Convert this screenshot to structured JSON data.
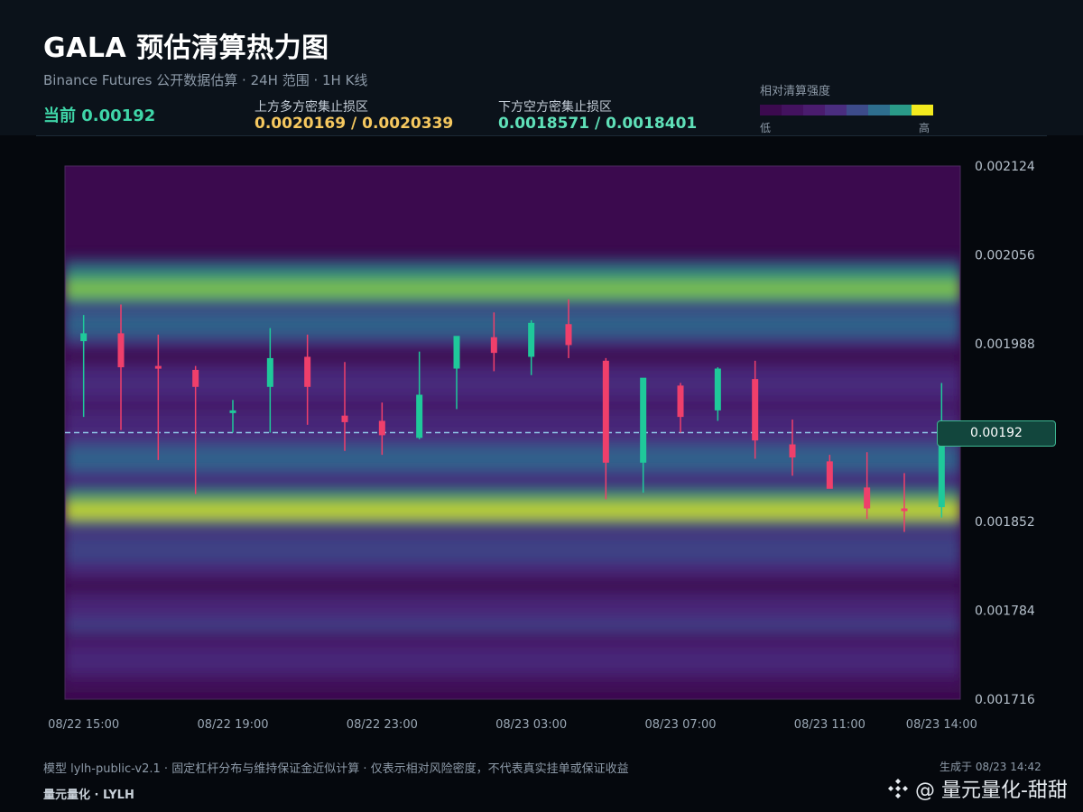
{
  "header": {
    "title": "GALA 预估清算热力图",
    "subtitle": "Binance Futures 公开数据估算 · 24H 范围 · 1H K线",
    "current": "当前 0.00192",
    "upper_zone_label": "上方多方密集止损区",
    "upper_zone_value": "0.0020169 / 0.0020339",
    "lower_zone_label": "下方空方密集止损区",
    "lower_zone_value": "0.0018571 / 0.0018401",
    "legend_title": "相对清算强度",
    "legend_low": "低",
    "legend_high": "高",
    "legend_colors": [
      "#3b0a4e",
      "#43125f",
      "#4a1c6e",
      "#4a2d7f",
      "#3d4b8a",
      "#2e6e8e",
      "#2a9a88",
      "#f3ea1e"
    ]
  },
  "colors": {
    "up": "#1fc99a",
    "down": "#ef3f6b",
    "current_line": "#8fc8e8",
    "upper_value": "#f6c85f",
    "lower_value": "#5fe0b8"
  },
  "chart_data": {
    "type": "heatmap",
    "overlay": "candlestick",
    "x_labels": [
      "08/22 15:00",
      "08/22 19:00",
      "08/22 23:00",
      "08/23 03:00",
      "08/23 07:00",
      "08/23 11:00",
      "08/23 14:00"
    ],
    "y_ticks": [
      "0.002124",
      "0.002056",
      "0.001988",
      "0.001920",
      "0.001852",
      "0.001784",
      "0.001716"
    ],
    "ylim": [
      0.001716,
      0.002124
    ],
    "current_price": 0.00192,
    "current_price_label": "0.00192",
    "candles": [
      {
        "o": 0.00199,
        "h": 0.00201,
        "l": 0.001932,
        "c": 0.001996
      },
      {
        "o": 0.001996,
        "h": 0.002018,
        "l": 0.001922,
        "c": 0.00197
      },
      {
        "o": 0.001971,
        "h": 0.001995,
        "l": 0.001899,
        "c": 0.001969
      },
      {
        "o": 0.001968,
        "h": 0.001971,
        "l": 0.001873,
        "c": 0.001955
      },
      {
        "o": 0.001935,
        "h": 0.001945,
        "l": 0.00192,
        "c": 0.001937
      },
      {
        "o": 0.001955,
        "h": 0.002,
        "l": 0.00192,
        "c": 0.001977
      },
      {
        "o": 0.001978,
        "h": 0.001995,
        "l": 0.001926,
        "c": 0.001955
      },
      {
        "o": 0.001933,
        "h": 0.001974,
        "l": 0.001906,
        "c": 0.001928
      },
      {
        "o": 0.001929,
        "h": 0.001943,
        "l": 0.001903,
        "c": 0.001918
      },
      {
        "o": 0.001916,
        "h": 0.001982,
        "l": 0.001915,
        "c": 0.001949
      },
      {
        "o": 0.001969,
        "h": 0.001991,
        "l": 0.001938,
        "c": 0.001994
      },
      {
        "o": 0.001993,
        "h": 0.002012,
        "l": 0.001967,
        "c": 0.001981
      },
      {
        "o": 0.001978,
        "h": 0.002006,
        "l": 0.001964,
        "c": 0.002004
      },
      {
        "o": 0.002003,
        "h": 0.002022,
        "l": 0.001977,
        "c": 0.001987
      },
      {
        "o": 0.001975,
        "h": 0.001977,
        "l": 0.001869,
        "c": 0.001897
      },
      {
        "o": 0.001897,
        "h": 0.001959,
        "l": 0.001874,
        "c": 0.001962
      },
      {
        "o": 0.001956,
        "h": 0.001958,
        "l": 0.00192,
        "c": 0.001932
      },
      {
        "o": 0.001937,
        "h": 0.00197,
        "l": 0.001929,
        "c": 0.001969
      },
      {
        "o": 0.001961,
        "h": 0.001975,
        "l": 0.0019,
        "c": 0.001914
      },
      {
        "o": 0.001911,
        "h": 0.00193,
        "l": 0.001887,
        "c": 0.001901
      },
      {
        "o": 0.001898,
        "h": 0.001903,
        "l": 0.00188,
        "c": 0.001877
      },
      {
        "o": 0.001878,
        "h": 0.001905,
        "l": 0.001854,
        "c": 0.001862
      },
      {
        "o": 0.001862,
        "h": 0.001889,
        "l": 0.001844,
        "c": 0.001861
      },
      {
        "o": 0.001863,
        "h": 0.001958,
        "l": 0.001855,
        "c": 0.001915
      }
    ],
    "bands": [
      {
        "center": 0.00191,
        "width": 2.5e-05,
        "intensity": 0.3
      },
      {
        "center": 0.00203,
        "width": 1.2e-05,
        "intensity": 0.85
      },
      {
        "center": 0.002002,
        "width": 1e-05,
        "intensity": 0.55
      },
      {
        "center": 0.001958,
        "width": 1e-05,
        "intensity": 0.3
      },
      {
        "center": 0.0019,
        "width": 1e-05,
        "intensity": 0.55
      },
      {
        "center": 0.00186,
        "width": 1e-05,
        "intensity": 1.0
      },
      {
        "center": 0.00183,
        "width": 1.2e-05,
        "intensity": 0.4
      },
      {
        "center": 0.00177,
        "width": 1.5e-05,
        "intensity": 0.35
      },
      {
        "center": 0.001745,
        "width": 1.2e-05,
        "intensity": 0.25
      }
    ]
  },
  "footer": {
    "note": "模型 lylh-public-v2.1 · 固定杠杆分布与维持保证金近似计算 · 仅表示相对风险密度，不代表真实挂单或保证收益",
    "brand": "量元量化 · LYLH",
    "generated": "生成于 08/23 14:42",
    "watermark": "@ 量元量化-甜甜"
  }
}
